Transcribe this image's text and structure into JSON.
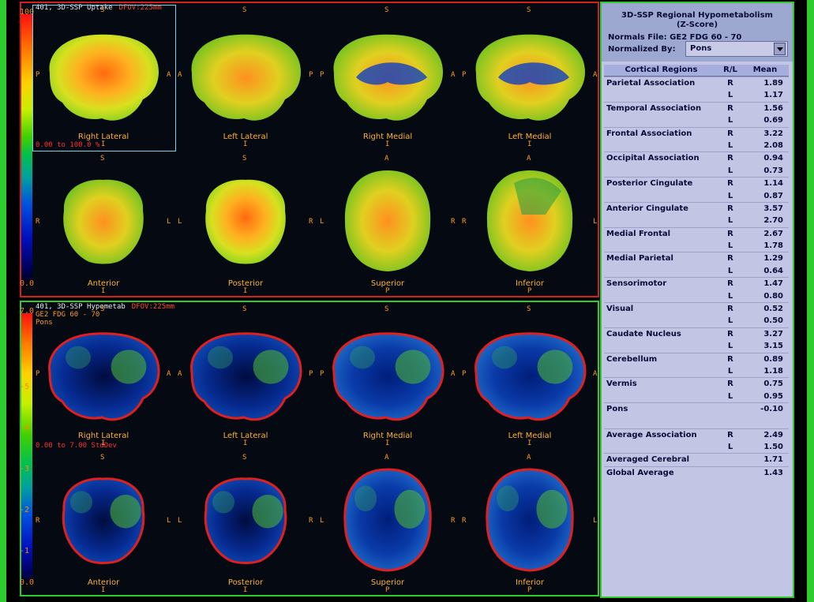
{
  "panels": [
    {
      "title": "401, 3D-SSP Uptake",
      "fov": "DFOV:225mm",
      "sub": [],
      "range": "0.00 to 100.0 %",
      "scale_top": "100",
      "scale_bottom": "0.0",
      "ticks": [],
      "views": [
        "Right Lateral",
        "Left Lateral",
        "Right Medial",
        "Left Medial",
        "Anterior",
        "Posterior",
        "Superior",
        "Inferior"
      ]
    },
    {
      "title": "401, 3D-SSP Hypometab",
      "fov": "DFOV:225mm",
      "sub": [
        "GE2 FDG 60 - 70",
        "Pons"
      ],
      "range": "0.00 to 7.00 StdDev",
      "scale_top": "7.0",
      "scale_bottom": "0.0",
      "ticks": [
        "-6",
        "-5",
        "-4",
        "-3",
        "-2",
        "-1"
      ],
      "views": [
        "Right Lateral",
        "Left Lateral",
        "Right Medial",
        "Left Medial",
        "Anterior",
        "Posterior",
        "Superior",
        "Inferior"
      ]
    }
  ],
  "orientation": {
    "top_row_sides": [
      [
        "P",
        "A"
      ],
      [
        "A",
        "P"
      ],
      [
        "P",
        "A"
      ],
      [
        "P",
        "A"
      ]
    ],
    "top_row_tops": [
      "S",
      "S",
      "S",
      "S"
    ],
    "top_row_bottoms": [
      "I",
      "I",
      "I",
      "I"
    ],
    "bottom_row_sides": [
      [
        "R",
        "L"
      ],
      [
        "L",
        "R"
      ],
      [
        "L",
        "R"
      ],
      [
        "R",
        "L"
      ]
    ],
    "bottom_row_tops": [
      "S",
      "S",
      "A",
      "A"
    ],
    "bottom_row_bottoms": [
      "I",
      "I",
      "P",
      "P"
    ]
  },
  "sidebar": {
    "title_line1": "3D-SSP Regional Hypometabolism",
    "title_line2": "(Z-Score)",
    "normals_file": "Normals File: GE2 FDG 60 - 70",
    "normalized_by_label": "Normalized By:",
    "normalized_by_value": "Pons",
    "columns": [
      "Cortical Regions",
      "R/L",
      "Mean"
    ],
    "regions": [
      {
        "name": "Parietal Association",
        "rows": [
          [
            "R",
            "1.89"
          ],
          [
            "L",
            "1.17"
          ]
        ]
      },
      {
        "name": "Temporal Association",
        "rows": [
          [
            "R",
            "1.56"
          ],
          [
            "L",
            "0.69"
          ]
        ]
      },
      {
        "name": "Frontal Association",
        "rows": [
          [
            "R",
            "3.22"
          ],
          [
            "L",
            "2.08"
          ]
        ]
      },
      {
        "name": "Occipital Association",
        "rows": [
          [
            "R",
            "0.94"
          ],
          [
            "L",
            "0.73"
          ]
        ]
      },
      {
        "name": "Posterior Cingulate",
        "rows": [
          [
            "R",
            "1.14"
          ],
          [
            "L",
            "0.87"
          ]
        ]
      },
      {
        "name": "Anterior Cingulate",
        "rows": [
          [
            "R",
            "3.57"
          ],
          [
            "L",
            "2.70"
          ]
        ]
      },
      {
        "name": "Medial Frontal",
        "rows": [
          [
            "R",
            "2.67"
          ],
          [
            "L",
            "1.78"
          ]
        ]
      },
      {
        "name": "Medial Parietal",
        "rows": [
          [
            "R",
            "1.29"
          ],
          [
            "L",
            "0.64"
          ]
        ]
      },
      {
        "name": "Sensorimotor",
        "rows": [
          [
            "R",
            "1.47"
          ],
          [
            "L",
            "0.80"
          ]
        ]
      },
      {
        "name": "Visual",
        "rows": [
          [
            "R",
            "0.52"
          ],
          [
            "L",
            "0.50"
          ]
        ]
      },
      {
        "name": "Caudate Nucleus",
        "rows": [
          [
            "R",
            "3.27"
          ],
          [
            "L",
            "3.15"
          ]
        ]
      },
      {
        "name": "Cerebellum",
        "rows": [
          [
            "R",
            "0.89"
          ],
          [
            "L",
            "1.18"
          ]
        ]
      },
      {
        "name": "Vermis",
        "rows": [
          [
            "R",
            "0.75"
          ],
          [
            "L",
            "0.95"
          ]
        ]
      },
      {
        "name": "Pons",
        "rows": [
          [
            "",
            "-0.10"
          ]
        ]
      }
    ],
    "summary": [
      {
        "name": "Average Association",
        "rows": [
          [
            "R",
            "2.49"
          ],
          [
            "L",
            "1.50"
          ]
        ]
      },
      {
        "name": "Averaged Cerebral",
        "rows": [
          [
            "",
            "1.71"
          ]
        ]
      },
      {
        "name": "Global Average",
        "rows": [
          [
            "",
            "1.43"
          ]
        ]
      }
    ]
  },
  "colors": {
    "frame": "#2ecc2e",
    "uptake_border": "#d02020",
    "label": "#ffb030",
    "sidebar_bg": "#c2c6e4"
  }
}
